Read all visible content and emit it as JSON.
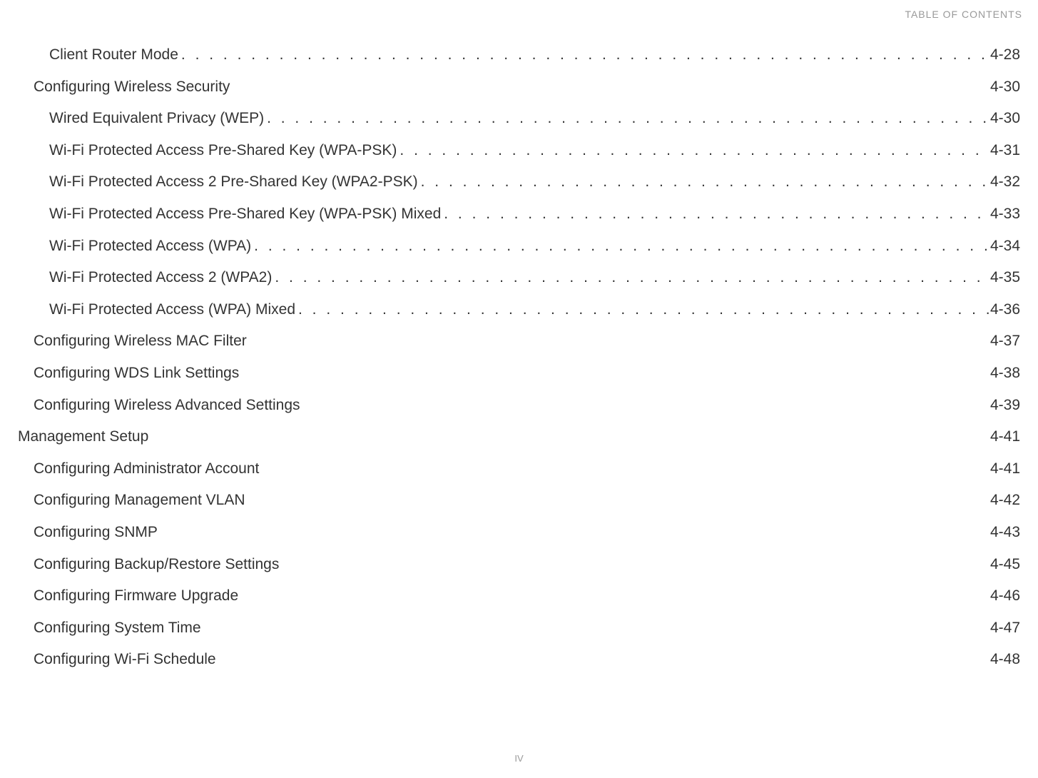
{
  "header": {
    "label": "TABLE OF CONTENTS"
  },
  "entries": [
    {
      "title": "Client Router Mode",
      "page": "4-28",
      "indent": 3,
      "dots": true
    },
    {
      "title": "Configuring Wireless Security",
      "page": "4-30",
      "indent": 2,
      "dots": false
    },
    {
      "title": "Wired Equivalent Privacy (WEP)",
      "page": "4-30",
      "indent": 3,
      "dots": true
    },
    {
      "title": "Wi-Fi Protected Access Pre-Shared Key (WPA-PSK)",
      "page": "4-31",
      "indent": 3,
      "dots": true
    },
    {
      "title": "Wi-Fi Protected Access 2 Pre-Shared Key (WPA2-PSK)",
      "page": "4-32",
      "indent": 3,
      "dots": true
    },
    {
      "title": "Wi-Fi Protected Access Pre-Shared Key (WPA-PSK) Mixed",
      "page": "4-33",
      "indent": 3,
      "dots": true
    },
    {
      "title": "Wi-Fi Protected Access (WPA)",
      "page": "4-34",
      "indent": 3,
      "dots": true
    },
    {
      "title": "Wi-Fi Protected Access 2 (WPA2)",
      "page": "4-35",
      "indent": 3,
      "dots": true
    },
    {
      "title": "Wi-Fi Protected Access (WPA) Mixed",
      "page": "4-36",
      "indent": 3,
      "dots": true
    },
    {
      "title": "Configuring Wireless MAC Filter",
      "page": "4-37",
      "indent": 2,
      "dots": false
    },
    {
      "title": "Configuring WDS Link Settings",
      "page": "4-38",
      "indent": 2,
      "dots": false
    },
    {
      "title": "Configuring Wireless Advanced Settings",
      "page": "4-39",
      "indent": 2,
      "dots": false
    },
    {
      "title": "Management Setup",
      "page": "4-41",
      "indent": 1,
      "dots": false
    },
    {
      "title": "Configuring Administrator Account",
      "page": "4-41",
      "indent": 2,
      "dots": false
    },
    {
      "title": "Configuring Management VLAN",
      "page": "4-42",
      "indent": 2,
      "dots": false
    },
    {
      "title": "Configuring SNMP",
      "page": "4-43",
      "indent": 2,
      "dots": false
    },
    {
      "title": "Configuring Backup/Restore Settings",
      "page": "4-45",
      "indent": 2,
      "dots": false
    },
    {
      "title": "Configuring Firmware Upgrade",
      "page": "4-46",
      "indent": 2,
      "dots": false
    },
    {
      "title": "Configuring System Time",
      "page": "4-47",
      "indent": 2,
      "dots": false
    },
    {
      "title": "Configuring Wi-Fi Schedule",
      "page": "4-48",
      "indent": 2,
      "dots": false
    }
  ],
  "footer": {
    "page_number": "IV"
  }
}
